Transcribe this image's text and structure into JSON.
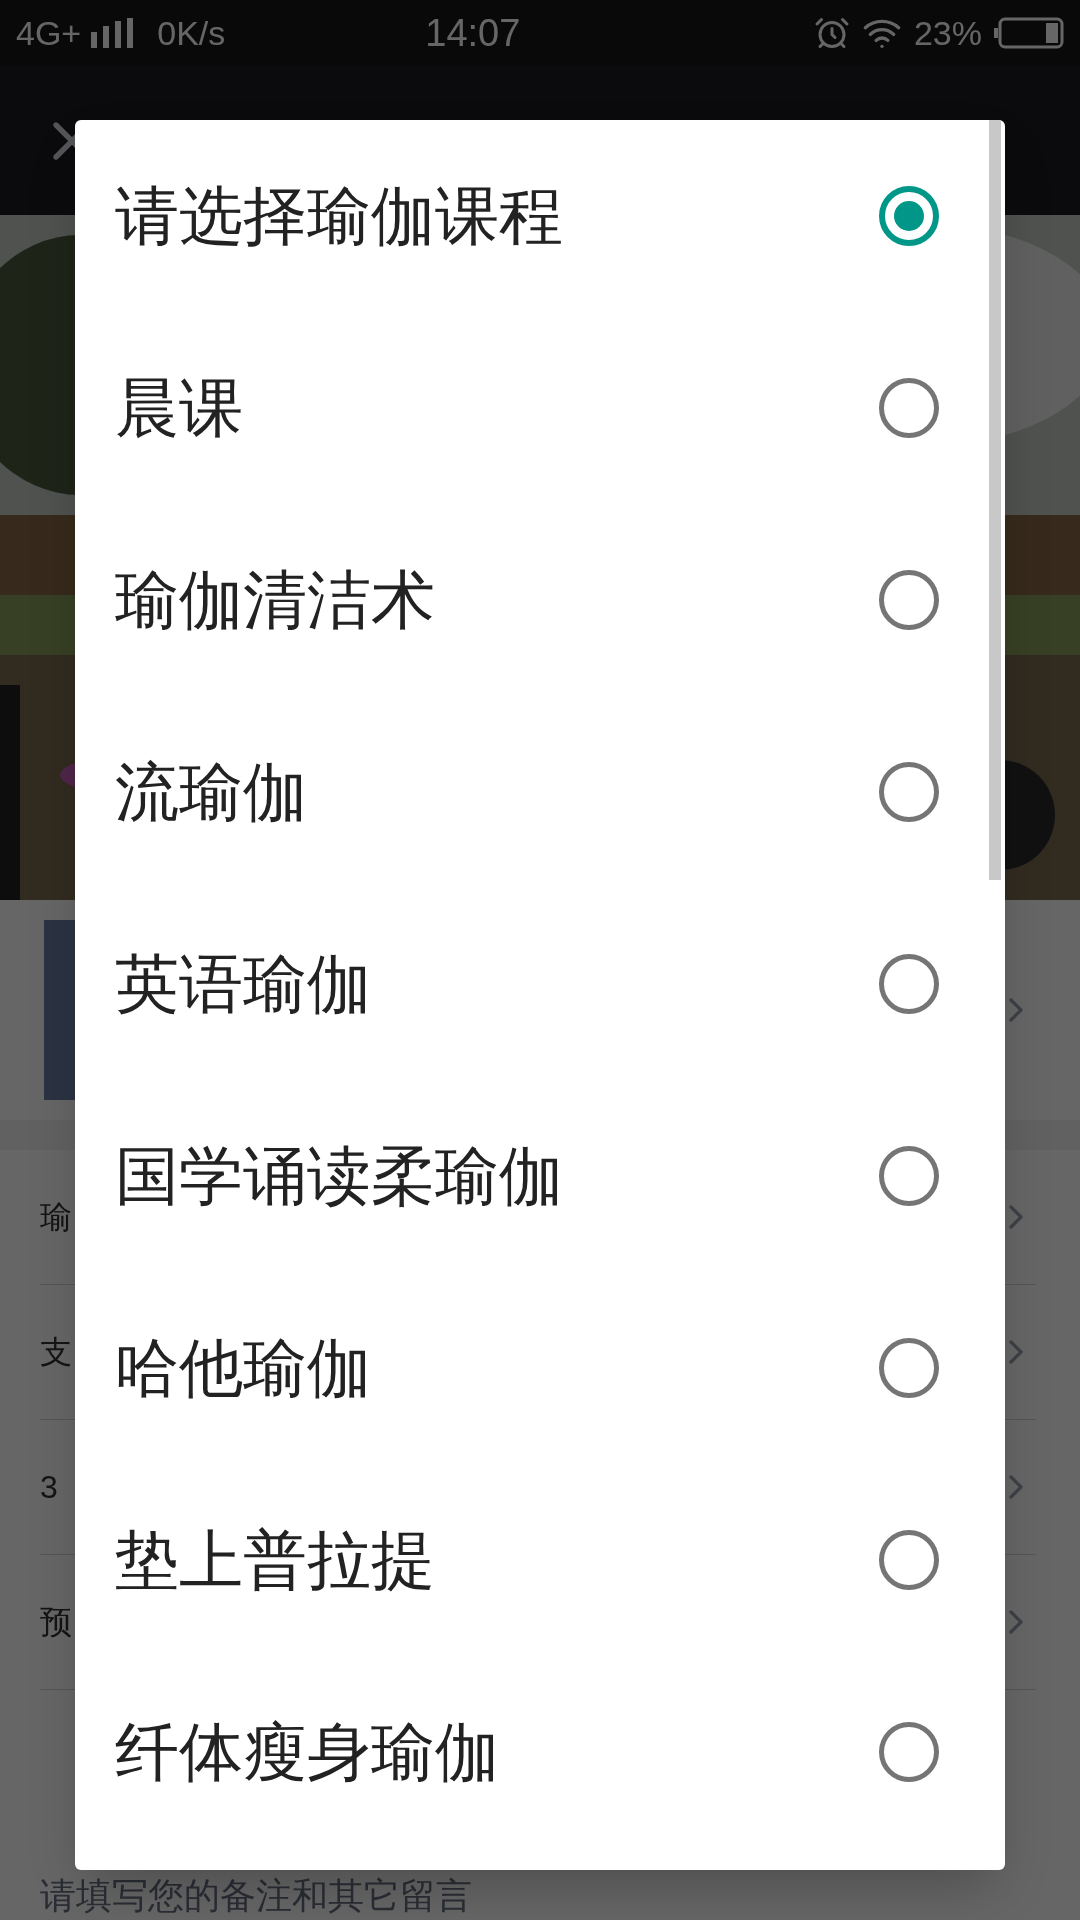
{
  "status_bar": {
    "network": "4G+",
    "speed": "0K/s",
    "time": "14:07",
    "battery": "23%"
  },
  "page": {
    "form_rows": [
      "瑜",
      "支",
      "3",
      "预"
    ],
    "remark": {
      "placeholder": "请填写您的备注和其它留言"
    }
  },
  "dialog": {
    "options": [
      {
        "label": "请选择瑜伽课程",
        "selected": true
      },
      {
        "label": "晨课",
        "selected": false
      },
      {
        "label": "瑜伽清洁术",
        "selected": false
      },
      {
        "label": "流瑜伽",
        "selected": false
      },
      {
        "label": "英语瑜伽",
        "selected": false
      },
      {
        "label": "国学诵读柔瑜伽",
        "selected": false
      },
      {
        "label": "哈他瑜伽",
        "selected": false
      },
      {
        "label": "垫上普拉提",
        "selected": false
      },
      {
        "label": "纤体瘦身瑜伽",
        "selected": false
      }
    ]
  }
}
